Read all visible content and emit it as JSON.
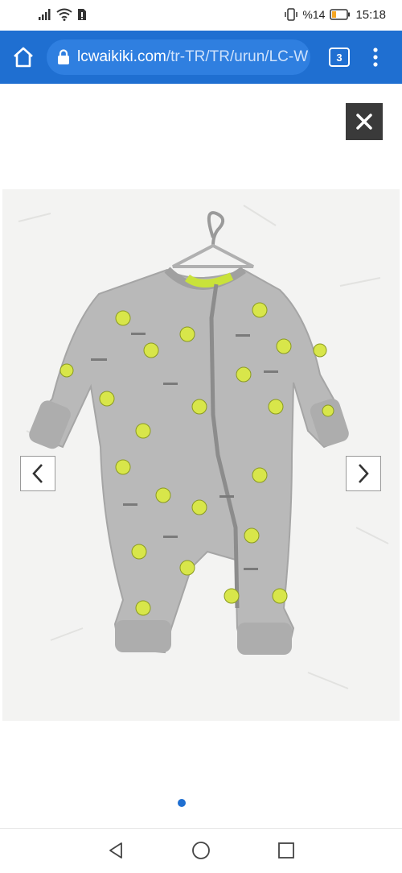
{
  "status_bar": {
    "battery_percent": "%14",
    "time": "15:18",
    "icons": [
      "signal-icon",
      "wifi-icon",
      "sim-icon",
      "vibrate-icon",
      "battery-icon"
    ]
  },
  "browser": {
    "url_main": "lcwaikiki.com",
    "url_path": "/tr-TR/TR/urun/LC-W",
    "tab_count": "3",
    "accent_color": "#1f6fd1"
  },
  "gallery": {
    "image_subject": "grey baby jumpsuit with yellow earth print on hanger",
    "active_slide": 1,
    "slide_count": 1
  }
}
